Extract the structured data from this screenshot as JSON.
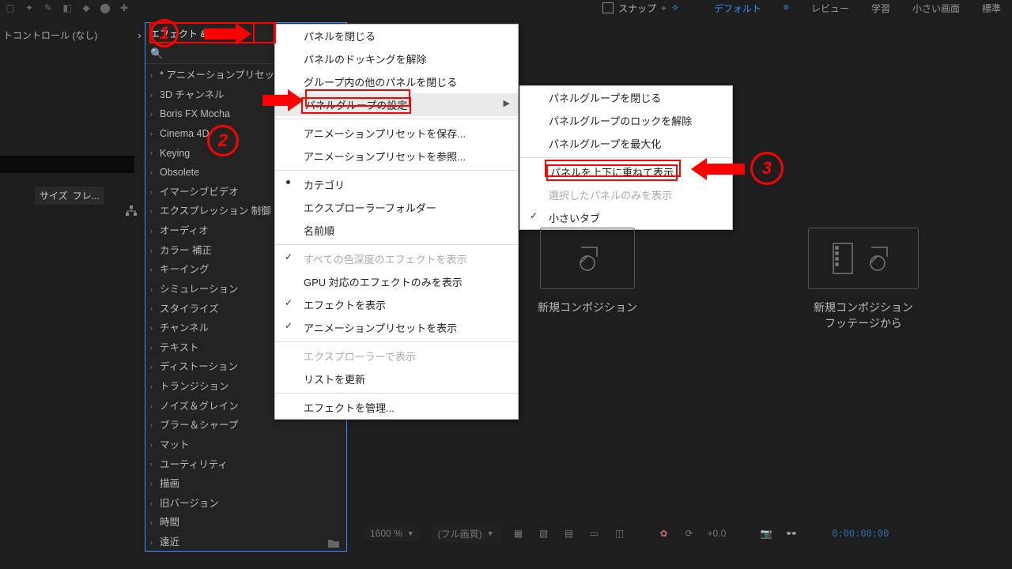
{
  "topbar": {
    "snap_label": "スナップ",
    "workspaces": [
      "デフォルト",
      "レビュー",
      "学習",
      "小さい画面",
      "標準"
    ]
  },
  "left_panel": {
    "effect_controls_label": "トコントロール (なし)"
  },
  "effects_panel": {
    "tab_label": "エフェクト &",
    "categories": [
      "* アニメーションプリセッ",
      "3D チャンネル",
      "Boris FX Mocha",
      "Cinema 4D",
      "Keying",
      "Obsolete",
      "イマーシブビデオ",
      "エクスプレッション 制御",
      "オーディオ",
      "カラー 補正",
      "キーイング",
      "シミュレーション",
      "スタイライズ",
      "チャンネル",
      "テキスト",
      "ディストーション",
      "トランジション",
      "ノイズ＆グレイン",
      "ブラー＆シャープ",
      "マット",
      "ユーティリティ",
      "描画",
      "旧バージョン",
      "時間",
      "遠近"
    ]
  },
  "left_size": {
    "size_label": "サイズ",
    "fre_label": "フレ..."
  },
  "context_menu_1": {
    "items": [
      {
        "label": "パネルを閉じる"
      },
      {
        "label": "パネルのドッキングを解除"
      },
      {
        "label": "グループ内の他のパネルを閉じる"
      },
      {
        "label": "パネルグループの設定",
        "sub": true,
        "hover": true,
        "hl": true
      },
      {
        "sep": true
      },
      {
        "label": "アニメーションプリセットを保存..."
      },
      {
        "label": "アニメーションプリセットを参照..."
      },
      {
        "sep": true
      },
      {
        "label": "カテゴリ",
        "bullet": true
      },
      {
        "label": "エクスプローラーフォルダー"
      },
      {
        "label": "名前順"
      },
      {
        "sep": true
      },
      {
        "label": "すべての色深度のエフェクトを表示",
        "check": true,
        "disabled": true
      },
      {
        "label": "GPU 対応のエフェクトのみを表示"
      },
      {
        "label": "エフェクトを表示",
        "check": true
      },
      {
        "label": "アニメーションプリセットを表示",
        "check": true
      },
      {
        "sep": true
      },
      {
        "label": "エクスプローラーで表示",
        "disabled": true
      },
      {
        "label": "リストを更新"
      },
      {
        "sep": true
      },
      {
        "label": "エフェクトを管理..."
      }
    ]
  },
  "context_menu_2": {
    "items": [
      {
        "label": "パネルグループを閉じる"
      },
      {
        "label": "パネルグループのロックを解除"
      },
      {
        "label": "パネルグループを最大化"
      },
      {
        "sep": true
      },
      {
        "label": "パネルを上下に重ねて表示",
        "hl": true
      },
      {
        "label": "選択したパネルのみを表示",
        "disabled": true
      },
      {
        "label": "小さいタブ",
        "check": true
      }
    ]
  },
  "composition": {
    "new_comp": "新規コンポジション",
    "new_comp_from_footage_l1": "新規コンポジション",
    "new_comp_from_footage_l2": "フッテージから"
  },
  "footer": {
    "zoom": "1600 %",
    "res": "(フル画質)",
    "exposure": "+0.0",
    "timecode": "0:00:00:00"
  },
  "annotations": {
    "n1": "1",
    "n2": "2",
    "n3": "3"
  }
}
